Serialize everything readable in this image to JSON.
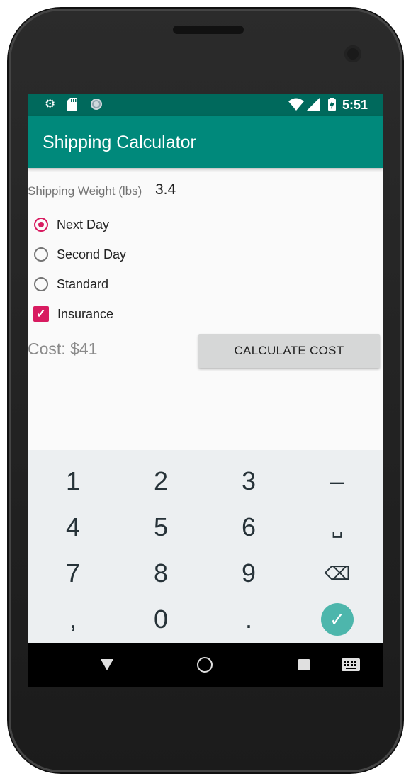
{
  "status_bar": {
    "time": "5:51",
    "icons": [
      "gear-icon",
      "sd-card-icon",
      "sync-circle-icon",
      "wifi-icon",
      "signal-icon",
      "battery-charging-icon"
    ]
  },
  "app_bar": {
    "title": "Shipping Calculator"
  },
  "form": {
    "weight_label": "Shipping Weight (lbs)",
    "weight_value": "3.4",
    "options": [
      {
        "label": "Next Day",
        "selected": true
      },
      {
        "label": "Second Day",
        "selected": false
      },
      {
        "label": "Standard",
        "selected": false
      }
    ],
    "insurance": {
      "label": "Insurance",
      "checked": true
    },
    "cost_text": "Cost: $41",
    "calculate_label": "CALCULATE COST"
  },
  "keyboard": {
    "rows": [
      [
        "1",
        "2",
        "3",
        "–"
      ],
      [
        "4",
        "5",
        "6",
        "␣"
      ],
      [
        "7",
        "8",
        "9",
        "⌫"
      ],
      [
        ",",
        "0",
        ".",
        "✓"
      ]
    ]
  },
  "colors": {
    "status_bar": "#00695c",
    "app_bar": "#00897b",
    "accent": "#d81b60",
    "keyboard_bg": "#eceff1",
    "done_key": "#4db6ac"
  }
}
